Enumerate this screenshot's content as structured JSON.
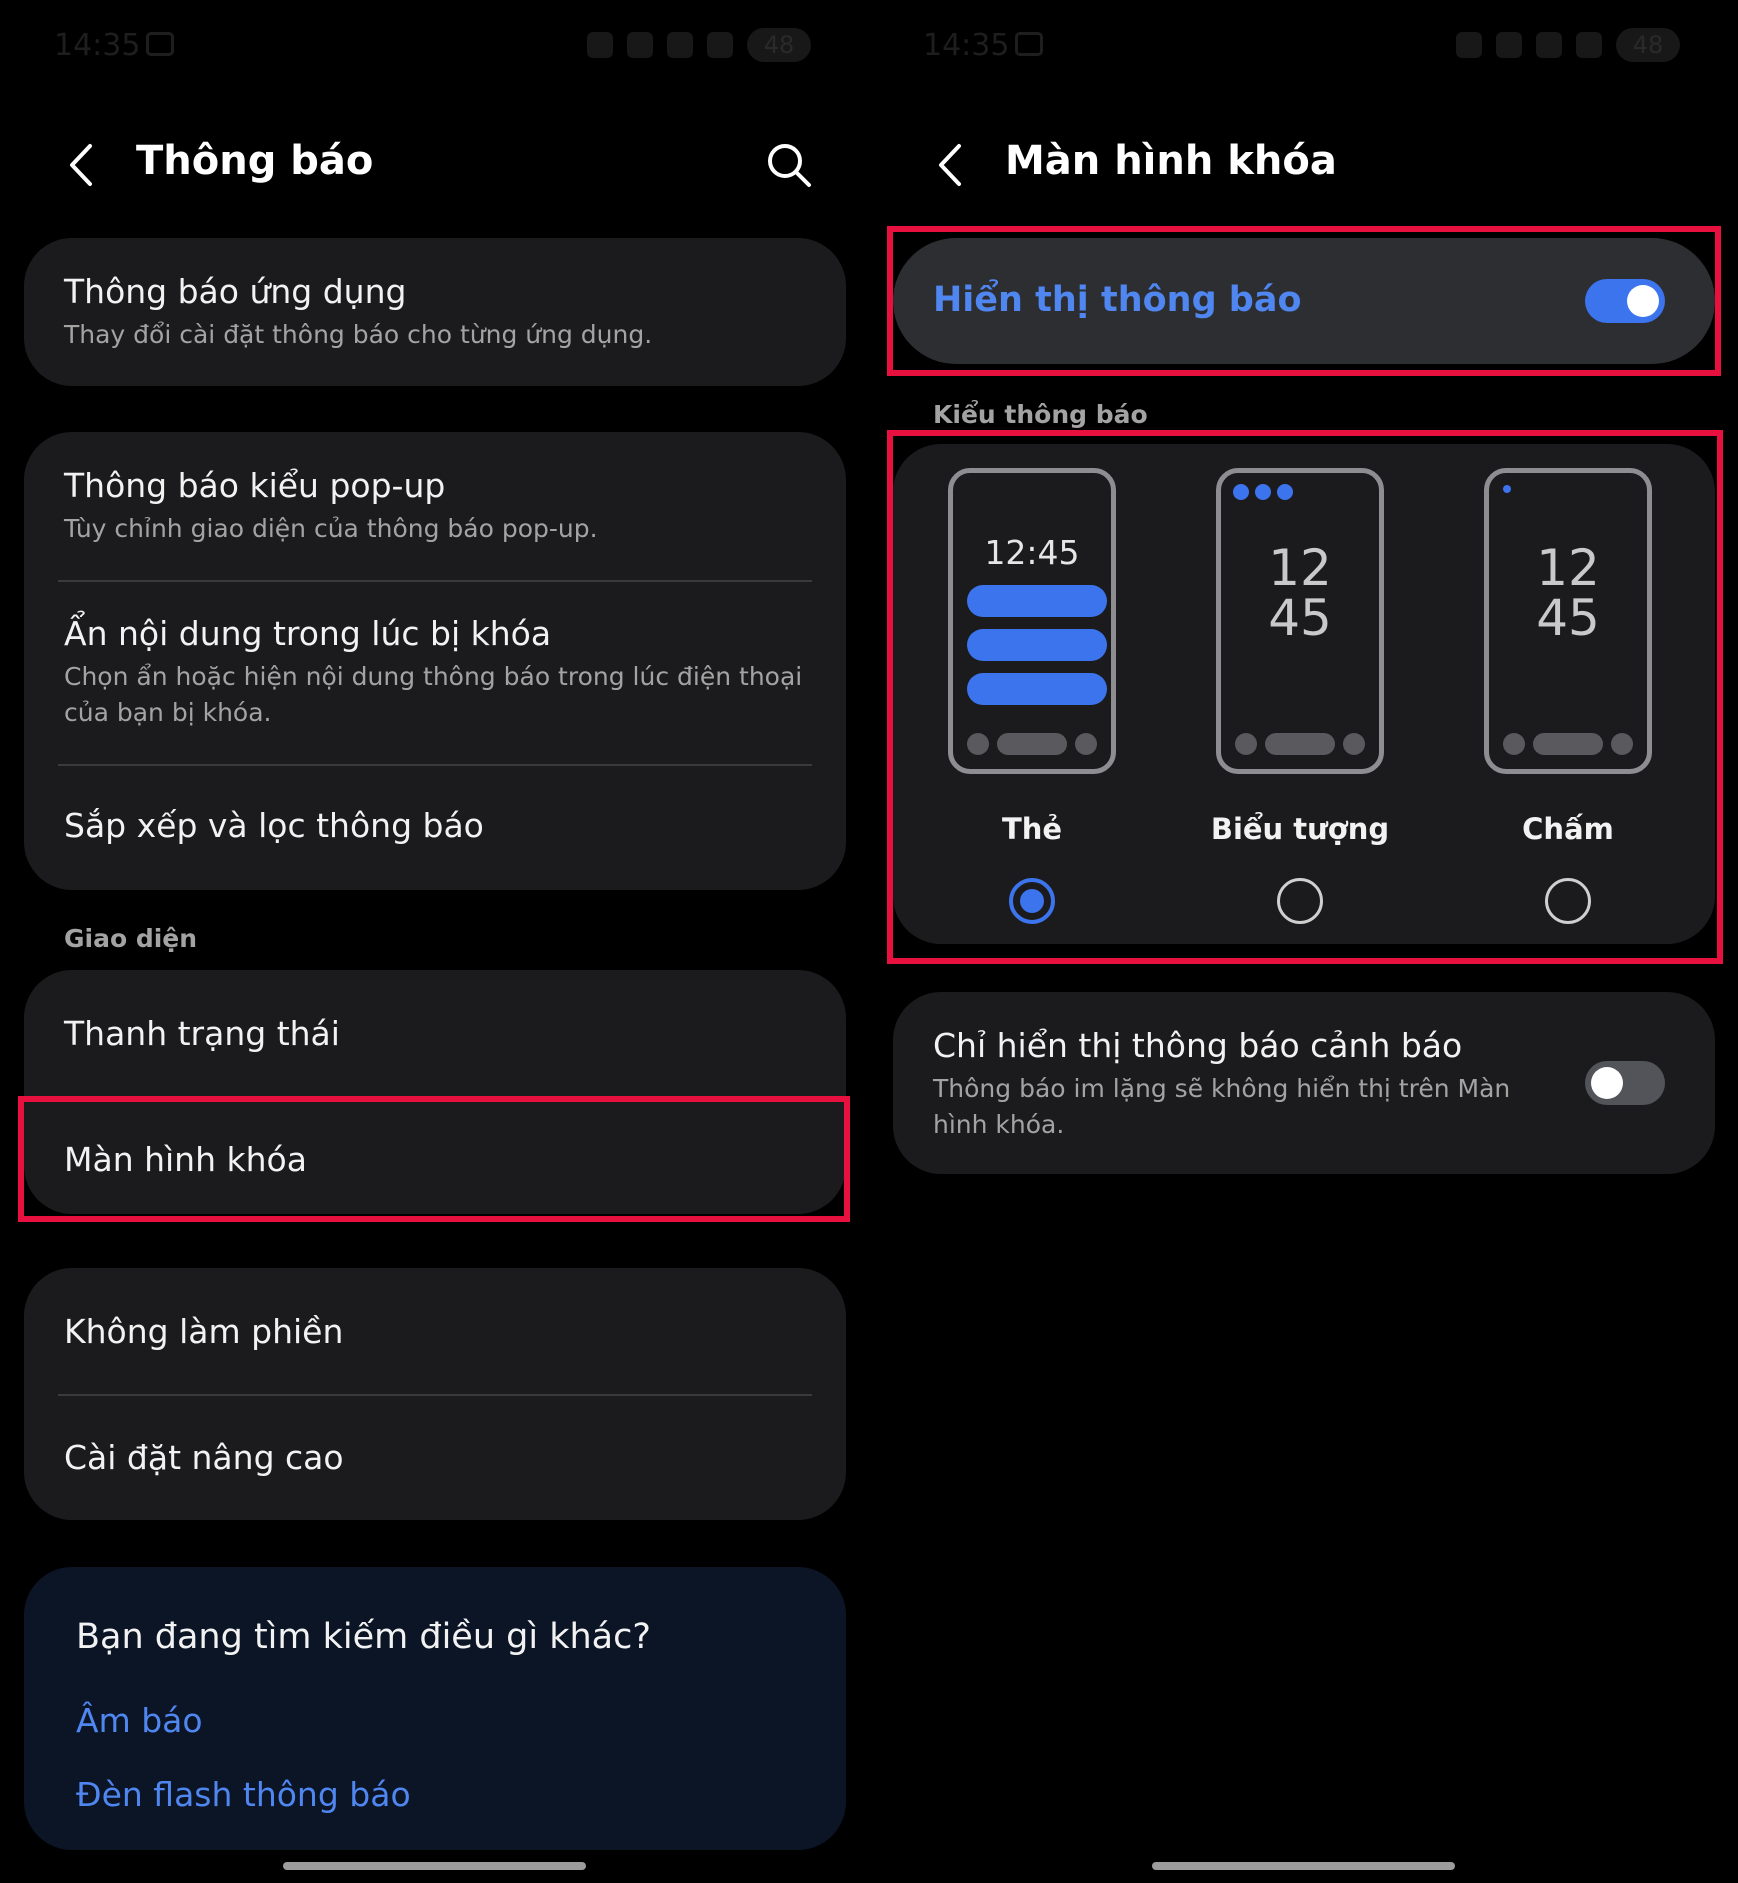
{
  "left": {
    "status": {
      "time": "14:35",
      "battery": "48"
    },
    "header": {
      "title": "Thông báo"
    },
    "items": {
      "app_notifications": {
        "title": "Thông báo ứng dụng",
        "subtitle": "Thay đổi cài đặt thông báo cho từng ứng dụng."
      },
      "popup": {
        "title": "Thông báo kiểu pop-up",
        "subtitle": "Tùy chỉnh giao diện của thông báo pop-up."
      },
      "hide_content": {
        "title": "Ẩn nội dung trong lúc bị khóa",
        "subtitle": "Chọn ẩn hoặc hiện nội dung thông báo trong lúc điện thoại của bạn bị khóa."
      },
      "sort_filter": {
        "title": "Sắp xếp và lọc thông báo"
      },
      "status_bar": {
        "title": "Thanh trạng thái"
      },
      "lock_screen": {
        "title": "Màn hình khóa"
      },
      "dnd": {
        "title": "Không làm phiền"
      },
      "advanced": {
        "title": "Cài đặt nâng cao"
      }
    },
    "section_appearance": "Giao diện",
    "help": {
      "title": "Bạn đang tìm kiếm điều gì khác?",
      "links": [
        "Âm báo",
        "Đèn flash thông báo"
      ]
    }
  },
  "right": {
    "status": {
      "time": "14:35",
      "battery": "48"
    },
    "header": {
      "title": "Màn hình khóa"
    },
    "show_notifications": {
      "label": "Hiển thị thông báo",
      "enabled": true
    },
    "section_style": "Kiểu thông báo",
    "styles": {
      "card": {
        "label": "Thẻ",
        "time": "12:45",
        "selected": true
      },
      "icon": {
        "label": "Biểu tượng",
        "hour": "12",
        "minute": "45",
        "selected": false
      },
      "dot": {
        "label": "Chấm",
        "hour": "12",
        "minute": "45",
        "selected": false
      }
    },
    "alert_only": {
      "title": "Chỉ hiển thị thông báo cảnh báo",
      "subtitle": "Thông báo im lặng sẽ không hiển thị trên Màn hình khóa.",
      "enabled": false
    }
  },
  "colors": {
    "accent": "#3c74ee",
    "link": "#4f86f0",
    "highlight": "#e8103e",
    "card": "#1b1b1d",
    "background": "#000000"
  }
}
